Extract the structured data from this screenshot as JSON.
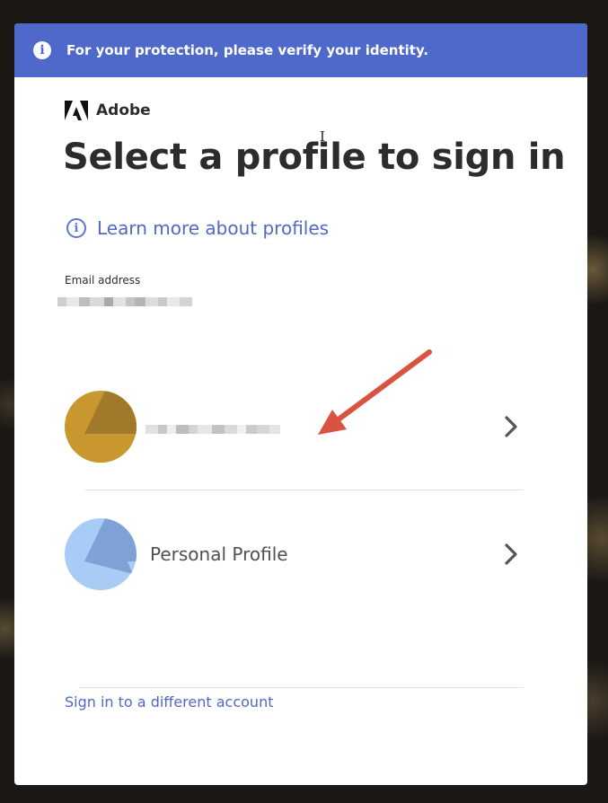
{
  "banner": {
    "icon": "info-icon",
    "text": "For your protection, please verify your identity.",
    "color": "#4e69c9"
  },
  "brand": {
    "logo_icon": "adobe-logo-icon",
    "name": "Adobe"
  },
  "page_title": "Select a profile to sign in",
  "learn_more": {
    "icon": "info-circle-icon",
    "label": "Learn more about profiles"
  },
  "email": {
    "label": "Email address",
    "value_state": "pixelated"
  },
  "profiles": [
    {
      "name_state": "pixelated",
      "avatar_colors": [
        "#c8972f",
        "#a07a2a"
      ],
      "chevron_icon": "chevron-right-icon"
    },
    {
      "name": "Personal Profile",
      "avatar_colors": [
        "#a9ccf7",
        "#7ea2d6"
      ],
      "chevron_icon": "chevron-right-icon"
    }
  ],
  "annotation": {
    "icon": "red-arrow-icon",
    "color": "#d95440"
  },
  "footer": {
    "different_account": "Sign in to a different account"
  },
  "colors": {
    "link": "#5168c4",
    "text": "#2c2c2c"
  }
}
